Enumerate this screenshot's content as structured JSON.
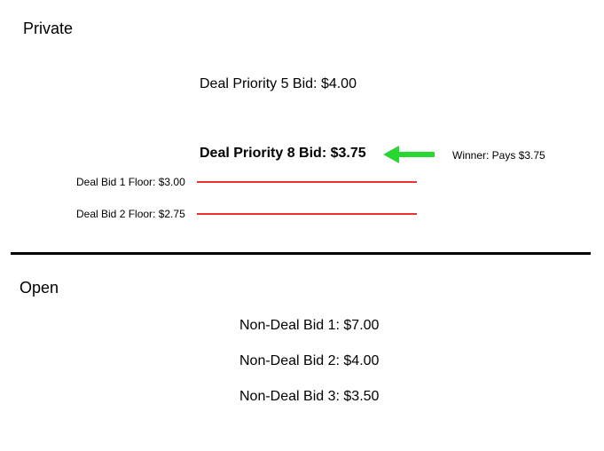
{
  "sections": {
    "private_label": "Private",
    "open_label": "Open"
  },
  "private": {
    "bid5_text": "Deal Priority 5 Bid: $4.00",
    "bid8_text": "Deal Priority 8 Bid: $3.75",
    "floor1_label": "Deal Bid 1 Floor: $3.00",
    "floor2_label": "Deal Bid 2 Floor: $2.75",
    "winner_text": "Winner: Pays $3.75"
  },
  "open": {
    "bid1_text": "Non-Deal Bid 1: $7.00",
    "bid2_text": "Non-Deal Bid 2: $4.00",
    "bid3_text": "Non-Deal Bid 3: $3.50"
  },
  "colors": {
    "floor_line": "#ee3030",
    "arrow": "#26d82f"
  }
}
